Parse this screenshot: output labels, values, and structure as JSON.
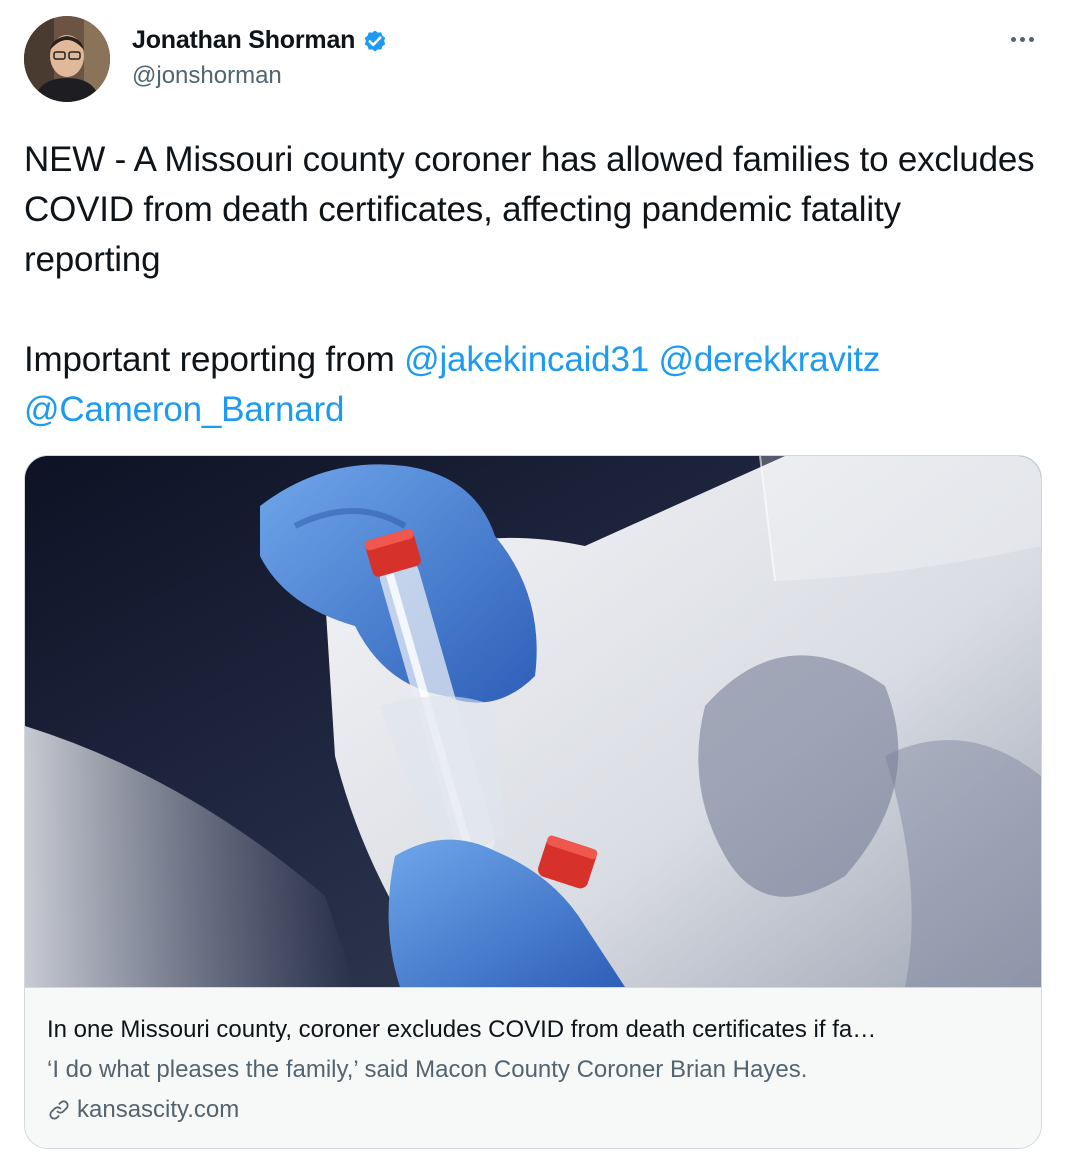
{
  "author": {
    "display_name": "Jonathan Shorman",
    "handle": "@jonshorman",
    "verified": true,
    "avatar_icon": "profile-photo"
  },
  "tweet": {
    "line1": "NEW - A Missouri county coroner has allowed families to excludes COVID from death certificates, affecting pandemic fatality reporting",
    "line2_prefix": "Important reporting from ",
    "mentions": [
      "@jakekincaid31",
      "@derekkravitz",
      "@Cameron_Barnard"
    ]
  },
  "card": {
    "image_description_icon": "covid-test-swab-photo",
    "title": "In one Missouri county, coroner excludes COVID from death certificates if fa…",
    "description": "‘I do what pleases the family,’ said Macon County Coroner Brian Hayes.",
    "domain": "kansascity.com"
  },
  "colors": {
    "link": "#1d9bf0",
    "secondary_text": "#536471",
    "verified_badge": "#1d9bf0"
  }
}
